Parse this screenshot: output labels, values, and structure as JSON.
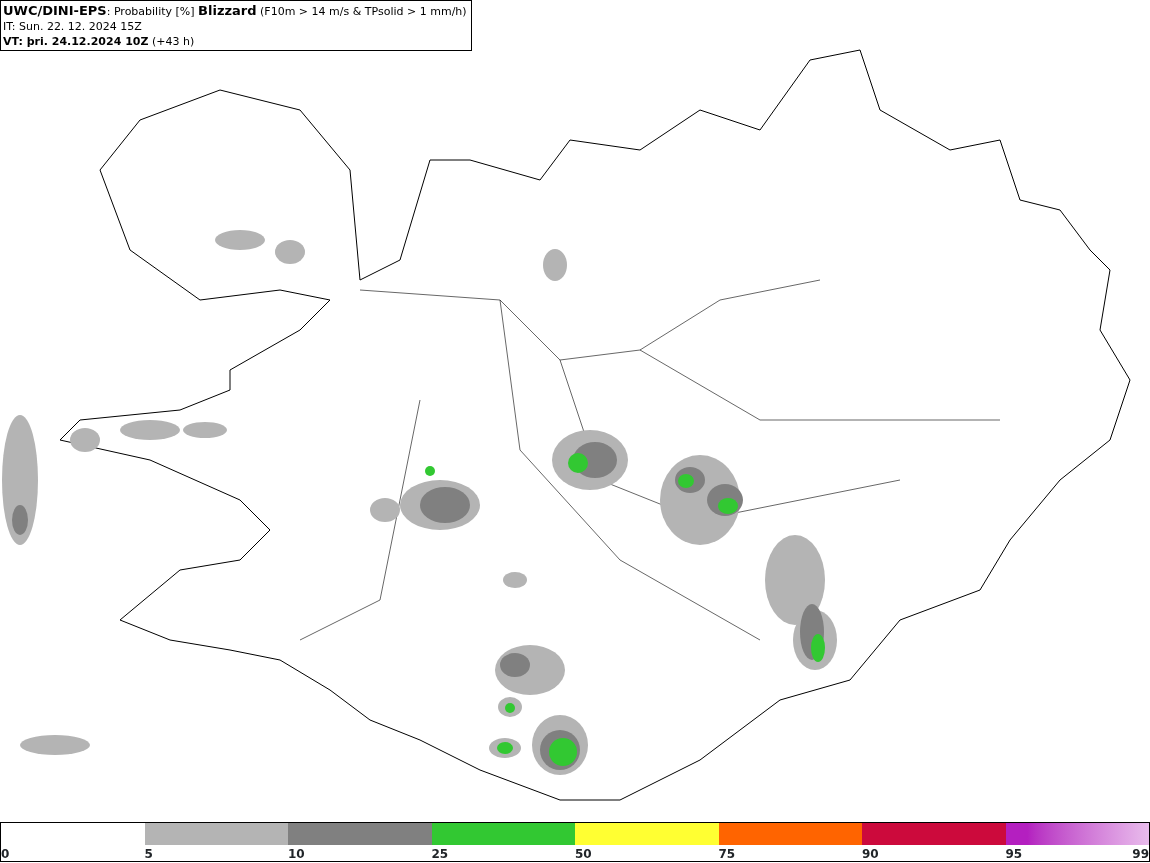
{
  "header": {
    "title": "**UWC/DINI-EPS**: Probability [%] **Blizzard** (F10m > 14 m/s & TPsolid > 1 mm/h)",
    "issue_time": "IT: Sun. 22. 12. 2024 15Z",
    "valid_time": "**VT: þri. 24.12.2024 10Z** (+43 h)"
  },
  "legend": {
    "segments": [
      {
        "color": "#b4b4b4"
      },
      {
        "color": "#808080"
      },
      {
        "color": "#32c832"
      },
      {
        "color": "#ffff32"
      },
      {
        "color": "#ff6400"
      },
      {
        "color": "#cc0a3c"
      },
      {
        "color": "#b41fc0",
        "kind": "gradient"
      }
    ],
    "labels": [
      "0",
      "5",
      "10",
      "25",
      "50",
      "75",
      "90",
      "95",
      "99"
    ]
  }
}
